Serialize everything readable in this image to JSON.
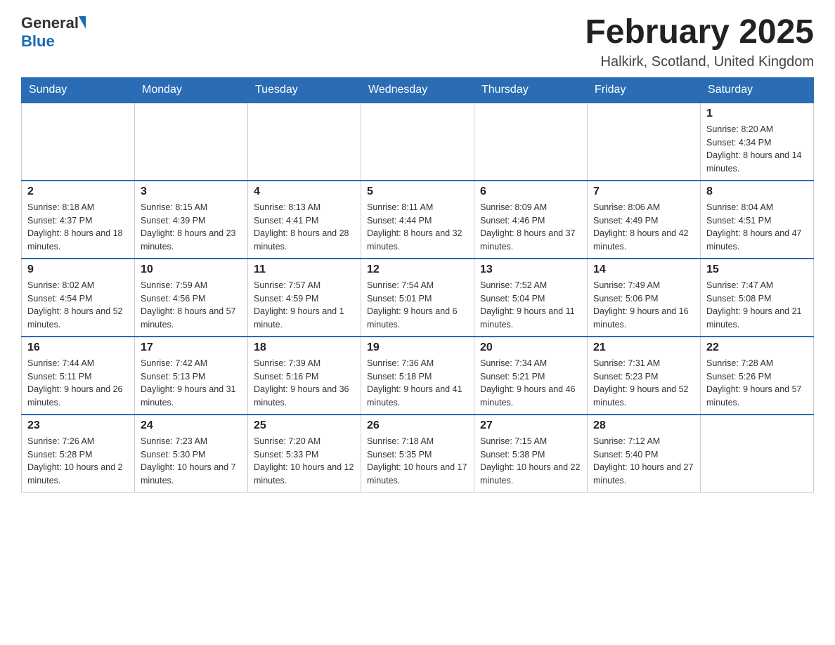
{
  "logo": {
    "general": "General",
    "blue": "Blue"
  },
  "title": "February 2025",
  "location": "Halkirk, Scotland, United Kingdom",
  "weekdays": [
    "Sunday",
    "Monday",
    "Tuesday",
    "Wednesday",
    "Thursday",
    "Friday",
    "Saturday"
  ],
  "weeks": [
    [
      {
        "day": "",
        "info": ""
      },
      {
        "day": "",
        "info": ""
      },
      {
        "day": "",
        "info": ""
      },
      {
        "day": "",
        "info": ""
      },
      {
        "day": "",
        "info": ""
      },
      {
        "day": "",
        "info": ""
      },
      {
        "day": "1",
        "info": "Sunrise: 8:20 AM\nSunset: 4:34 PM\nDaylight: 8 hours and 14 minutes."
      }
    ],
    [
      {
        "day": "2",
        "info": "Sunrise: 8:18 AM\nSunset: 4:37 PM\nDaylight: 8 hours and 18 minutes."
      },
      {
        "day": "3",
        "info": "Sunrise: 8:15 AM\nSunset: 4:39 PM\nDaylight: 8 hours and 23 minutes."
      },
      {
        "day": "4",
        "info": "Sunrise: 8:13 AM\nSunset: 4:41 PM\nDaylight: 8 hours and 28 minutes."
      },
      {
        "day": "5",
        "info": "Sunrise: 8:11 AM\nSunset: 4:44 PM\nDaylight: 8 hours and 32 minutes."
      },
      {
        "day": "6",
        "info": "Sunrise: 8:09 AM\nSunset: 4:46 PM\nDaylight: 8 hours and 37 minutes."
      },
      {
        "day": "7",
        "info": "Sunrise: 8:06 AM\nSunset: 4:49 PM\nDaylight: 8 hours and 42 minutes."
      },
      {
        "day": "8",
        "info": "Sunrise: 8:04 AM\nSunset: 4:51 PM\nDaylight: 8 hours and 47 minutes."
      }
    ],
    [
      {
        "day": "9",
        "info": "Sunrise: 8:02 AM\nSunset: 4:54 PM\nDaylight: 8 hours and 52 minutes."
      },
      {
        "day": "10",
        "info": "Sunrise: 7:59 AM\nSunset: 4:56 PM\nDaylight: 8 hours and 57 minutes."
      },
      {
        "day": "11",
        "info": "Sunrise: 7:57 AM\nSunset: 4:59 PM\nDaylight: 9 hours and 1 minute."
      },
      {
        "day": "12",
        "info": "Sunrise: 7:54 AM\nSunset: 5:01 PM\nDaylight: 9 hours and 6 minutes."
      },
      {
        "day": "13",
        "info": "Sunrise: 7:52 AM\nSunset: 5:04 PM\nDaylight: 9 hours and 11 minutes."
      },
      {
        "day": "14",
        "info": "Sunrise: 7:49 AM\nSunset: 5:06 PM\nDaylight: 9 hours and 16 minutes."
      },
      {
        "day": "15",
        "info": "Sunrise: 7:47 AM\nSunset: 5:08 PM\nDaylight: 9 hours and 21 minutes."
      }
    ],
    [
      {
        "day": "16",
        "info": "Sunrise: 7:44 AM\nSunset: 5:11 PM\nDaylight: 9 hours and 26 minutes."
      },
      {
        "day": "17",
        "info": "Sunrise: 7:42 AM\nSunset: 5:13 PM\nDaylight: 9 hours and 31 minutes."
      },
      {
        "day": "18",
        "info": "Sunrise: 7:39 AM\nSunset: 5:16 PM\nDaylight: 9 hours and 36 minutes."
      },
      {
        "day": "19",
        "info": "Sunrise: 7:36 AM\nSunset: 5:18 PM\nDaylight: 9 hours and 41 minutes."
      },
      {
        "day": "20",
        "info": "Sunrise: 7:34 AM\nSunset: 5:21 PM\nDaylight: 9 hours and 46 minutes."
      },
      {
        "day": "21",
        "info": "Sunrise: 7:31 AM\nSunset: 5:23 PM\nDaylight: 9 hours and 52 minutes."
      },
      {
        "day": "22",
        "info": "Sunrise: 7:28 AM\nSunset: 5:26 PM\nDaylight: 9 hours and 57 minutes."
      }
    ],
    [
      {
        "day": "23",
        "info": "Sunrise: 7:26 AM\nSunset: 5:28 PM\nDaylight: 10 hours and 2 minutes."
      },
      {
        "day": "24",
        "info": "Sunrise: 7:23 AM\nSunset: 5:30 PM\nDaylight: 10 hours and 7 minutes."
      },
      {
        "day": "25",
        "info": "Sunrise: 7:20 AM\nSunset: 5:33 PM\nDaylight: 10 hours and 12 minutes."
      },
      {
        "day": "26",
        "info": "Sunrise: 7:18 AM\nSunset: 5:35 PM\nDaylight: 10 hours and 17 minutes."
      },
      {
        "day": "27",
        "info": "Sunrise: 7:15 AM\nSunset: 5:38 PM\nDaylight: 10 hours and 22 minutes."
      },
      {
        "day": "28",
        "info": "Sunrise: 7:12 AM\nSunset: 5:40 PM\nDaylight: 10 hours and 27 minutes."
      },
      {
        "day": "",
        "info": ""
      }
    ]
  ]
}
